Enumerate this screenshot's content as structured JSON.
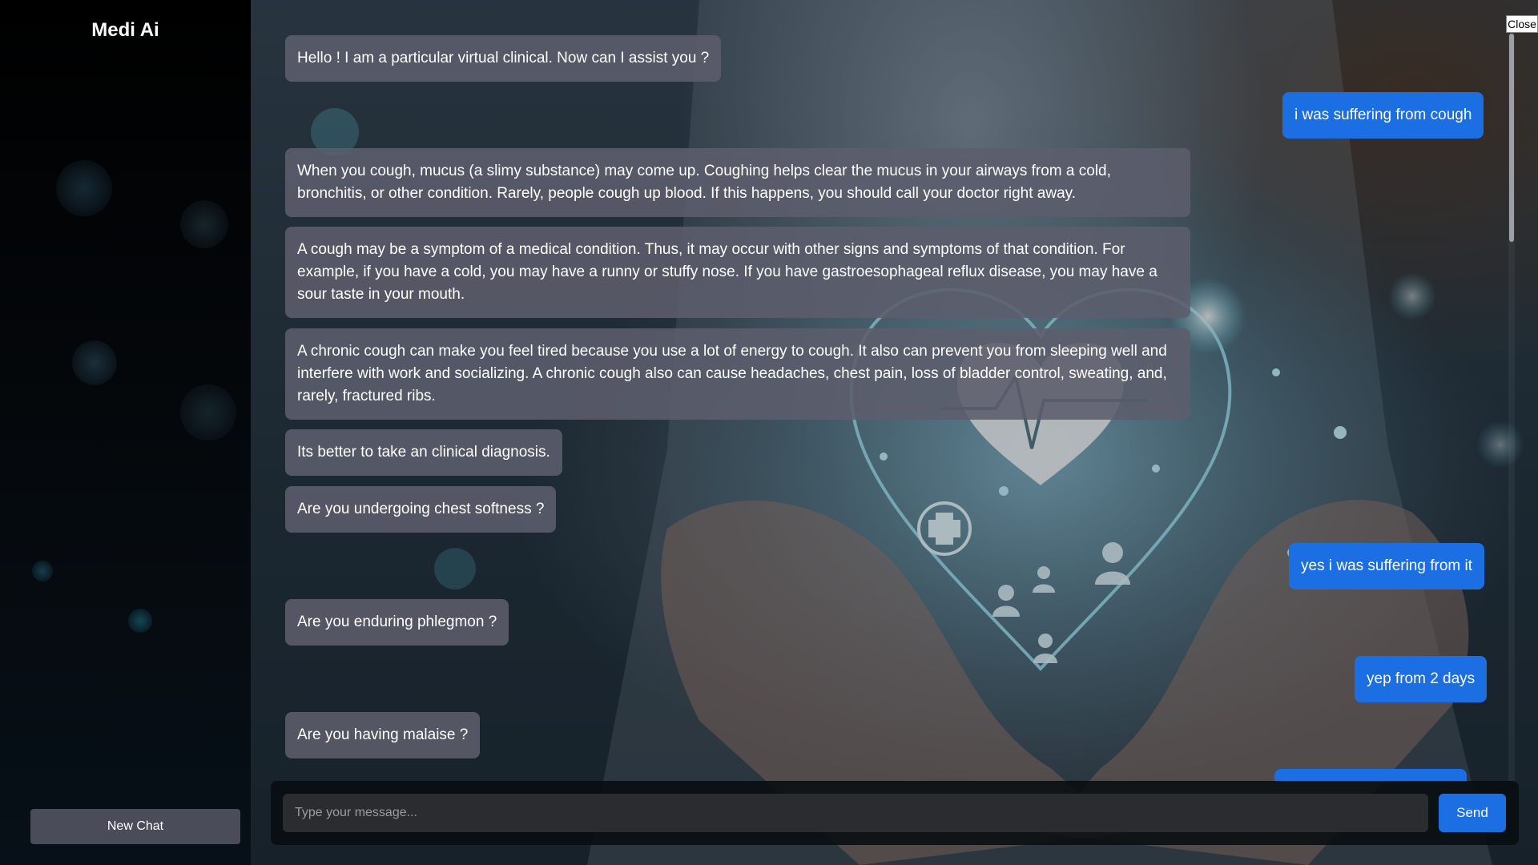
{
  "sidebar": {
    "brand": "Medi Ai",
    "new_chat_label": "New Chat"
  },
  "window": {
    "close_label": "Close"
  },
  "chat": {
    "messages": [
      {
        "role": "bot",
        "text": "Hello ! I am a particular virtual clinical. Now can I assist you ?"
      },
      {
        "role": "user",
        "text": "i was suffering from cough"
      },
      {
        "role": "bot",
        "text": "When you cough, mucus (a slimy substance) may come up. Coughing helps clear the mucus in your airways from a cold, bronchitis, or other condition. Rarely, people cough up blood. If this happens, you should call your doctor right away."
      },
      {
        "role": "bot",
        "text": "A cough may be a symptom of a medical condition. Thus, it may occur with other signs and symptoms of that condition. For example, if you have a cold, you may have a runny or stuffy nose. If you have gastroesophageal reflux disease, you may have a sour taste in your mouth."
      },
      {
        "role": "bot",
        "text": "A chronic cough can make you feel tired because you use a lot of energy to cough. It also can prevent you from sleeping well and interfere with work and socializing. A chronic cough also can cause headaches, chest pain, loss of bladder control, sweating, and, rarely, fractured ribs."
      },
      {
        "role": "bot",
        "text": "Its better to take an clinical diagnosis."
      },
      {
        "role": "bot",
        "text": "Are you undergoing chest softness ?"
      },
      {
        "role": "user",
        "text": "yes i was suffering from it"
      },
      {
        "role": "bot",
        "text": "Are you enduring phlegmon ?"
      },
      {
        "role": "user",
        "text": "yep from 2 days"
      },
      {
        "role": "bot",
        "text": "Are you having malaise ?"
      }
    ]
  },
  "composer": {
    "placeholder": "Type your message...",
    "value": "",
    "send_label": "Send"
  },
  "colors": {
    "user_bubble": "#1b6fe3",
    "bot_bubble": "#5c5d6c",
    "sidebar": "#000000",
    "new_chat_button": "#4a4c5a",
    "send_button": "#1b6fe3"
  },
  "icons": [
    "heart-hologram-icon",
    "medical-cross-icon",
    "person-icon"
  ]
}
